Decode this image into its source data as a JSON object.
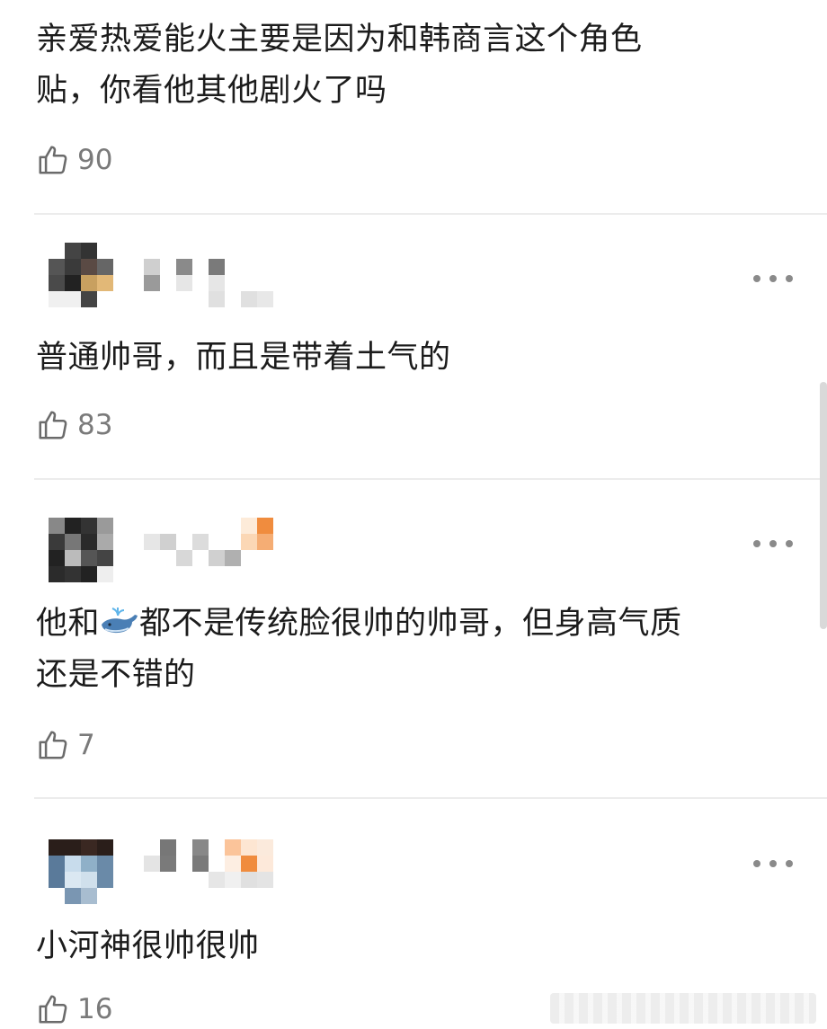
{
  "comments": [
    {
      "text_line1": "亲爱热爱能火主要是因为和韩商言这个角色",
      "text_line2": "贴，你看他其他剧火了吗",
      "likes": "90"
    },
    {
      "text": "普通帅哥，而且是带着土气的",
      "likes": "83"
    },
    {
      "text_before": "他和",
      "text_after_line1": "都不是传统脸很帅的帅哥，但身高气质",
      "text_line2": "还是不错的",
      "likes": "7",
      "emoji_icon": "whale-emoji-icon"
    },
    {
      "text": "小河神很帅很帅",
      "likes": "16"
    }
  ],
  "icons": {
    "like": "thumbs-up-icon",
    "more": "more-dots-icon"
  },
  "colors": {
    "text": "#1c1c1c",
    "meta": "#7a7a7a",
    "divider": "#ececec"
  }
}
